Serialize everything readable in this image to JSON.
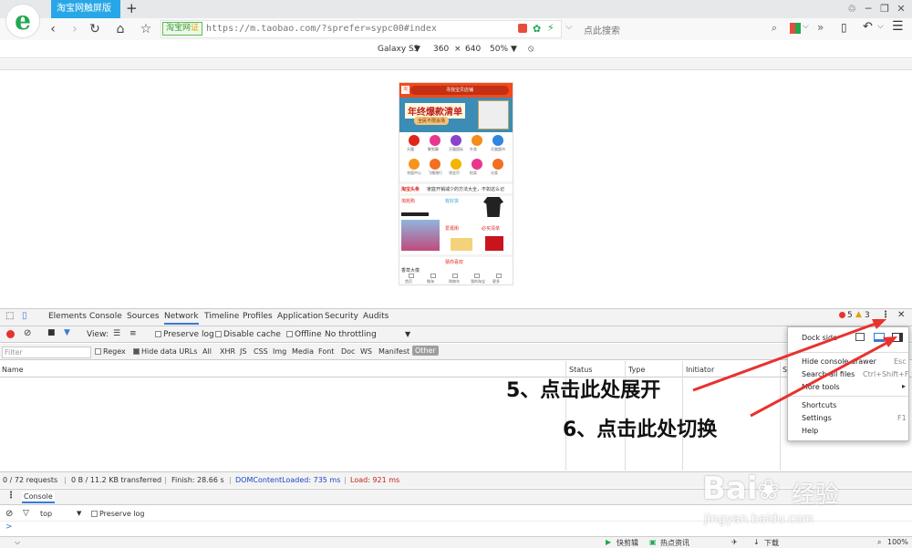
{
  "browser": {
    "tab_title": "淘宝网触屏版",
    "new_tab": "+",
    "site_badge": "淘宝网",
    "badge_verify": "证",
    "url": "https://m.taobao.com/?sprefer=sypc00#index",
    "search_placeholder": "点此搜索"
  },
  "device_toolbar": {
    "device": "Galaxy S5",
    "width": "360",
    "times": "×",
    "height": "640",
    "zoom": "50%"
  },
  "phone": {
    "search_text": "寻找宝贝店铺",
    "banner_title": "年终爆款清单",
    "banner_sub": "全民不限会场",
    "icons_row1": [
      "天猫",
      "聚划算",
      "天猫国际",
      "外卖",
      "天猫超市"
    ],
    "icons_row2": [
      "充值中心",
      "飞猪旅行",
      "领金币",
      "拍卖",
      "分类"
    ],
    "headline_label": "淘宝头条",
    "headline_text": "家庭开销减少的方法大全，不如这么记",
    "cards": [
      "淘抢购",
      "有好货",
      "爱逛街",
      "必买清单"
    ],
    "section_title": "猜你喜欢",
    "bottom_nav": [
      "首页",
      "微淘",
      "购物车",
      "我的淘宝",
      "更多"
    ],
    "footer_item": "香草大葆"
  },
  "devtools": {
    "tabs": [
      "Elements",
      "Console",
      "Sources",
      "Network",
      "Timeline",
      "Profiles",
      "Application",
      "Security",
      "Audits"
    ],
    "error_count": "5",
    "warning_count": "3",
    "view_label": "View:",
    "preserve_log": "Preserve log",
    "disable_cache": "Disable cache",
    "offline": "Offline",
    "throttling": "No throttling",
    "filter_placeholder": "Filter",
    "regex": "Regex",
    "hide_data_urls": "Hide data URLs",
    "filter_types": [
      "All",
      "XHR",
      "JS",
      "CSS",
      "Img",
      "Media",
      "Font",
      "Doc",
      "WS",
      "Manifest"
    ],
    "filter_other": "Other",
    "columns": [
      "Name",
      "Status",
      "Type",
      "Initiator",
      "S"
    ],
    "status": {
      "requests": "0 / 72 requests",
      "transferred": "0 B / 11.2 KB transferred",
      "finish": "Finish: 28.66 s",
      "dom_loaded": "DOMContentLoaded: 735 ms",
      "load": "Load: 921 ms"
    },
    "drawer_tab": "Console",
    "context": "top",
    "drawer_preserve": "Preserve log",
    "prompt": ">"
  },
  "menu": {
    "dock_side": "Dock side",
    "hide_console": "Hide console drawer",
    "hide_console_shortcut": "Esc",
    "search_all": "Search all files",
    "search_all_shortcut": "Ctrl+Shift+F",
    "more_tools": "More tools",
    "shortcuts": "Shortcuts",
    "settings": "Settings",
    "settings_shortcut": "F1",
    "help": "Help"
  },
  "annotations": {
    "step5": "5、点击此处展开",
    "step6": "6、点击此处切换",
    "arrow_color": "#e8322f"
  },
  "bottom_status": {
    "clipboard": "快剪辑",
    "hot_news": "热点资讯",
    "download": "下载",
    "zoom": "100%"
  },
  "watermark": {
    "brand": "Bai",
    "brand2": "经验",
    "url": "jingyan.baidu.com"
  }
}
